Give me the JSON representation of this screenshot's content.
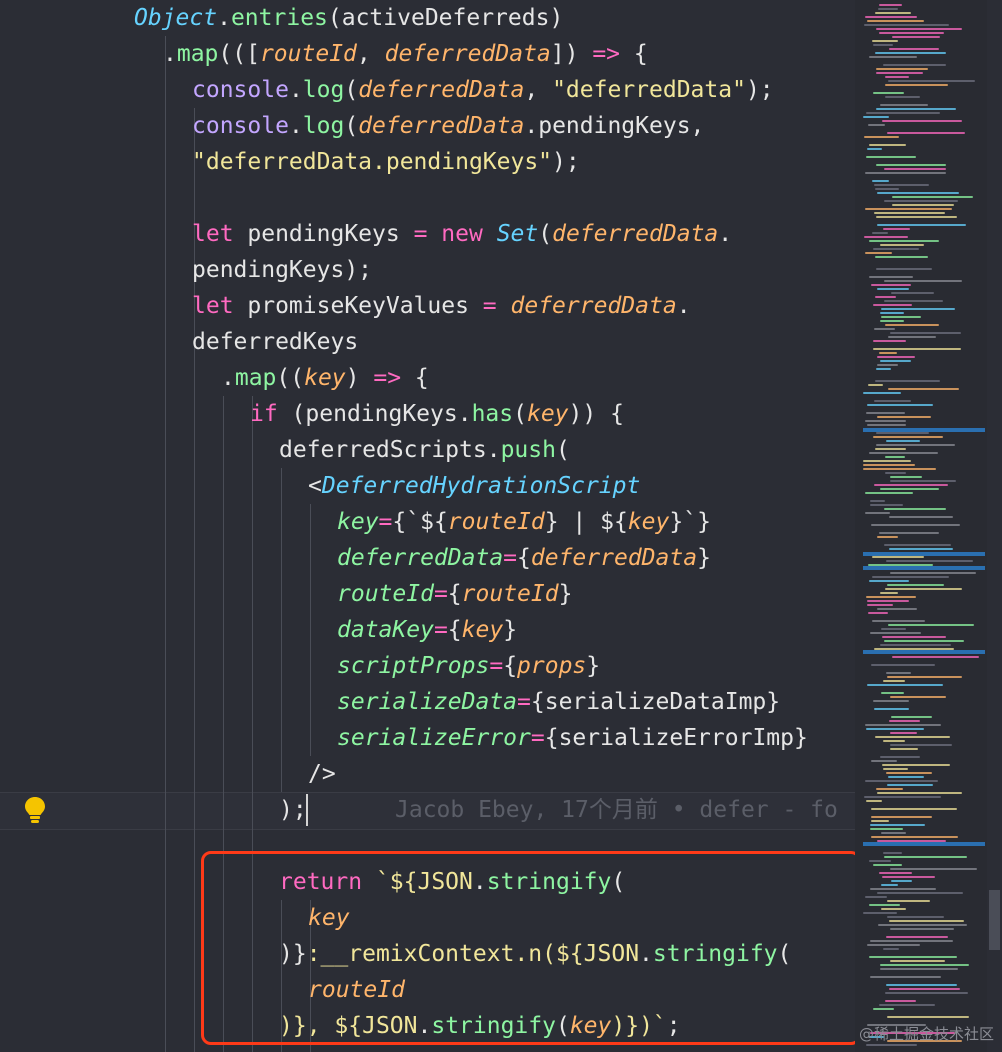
{
  "code_lines": [
    {
      "indent": 134,
      "tokens": [
        {
          "t": "Object",
          "c": "cls"
        },
        {
          "t": ".",
          "c": ""
        },
        {
          "t": "entries",
          "c": "fn"
        },
        {
          "t": "(activeDeferreds)",
          "c": ""
        }
      ]
    },
    {
      "indent": 163,
      "tokens": [
        {
          "t": ".",
          "c": ""
        },
        {
          "t": "map",
          "c": "fn"
        },
        {
          "t": "(([",
          "c": ""
        },
        {
          "t": "routeId",
          "c": "prm"
        },
        {
          "t": ", ",
          "c": ""
        },
        {
          "t": "deferredData",
          "c": "prm"
        },
        {
          "t": "]) ",
          "c": ""
        },
        {
          "t": "=>",
          "c": "op"
        },
        {
          "t": " {",
          "c": ""
        }
      ]
    },
    {
      "indent": 192,
      "tokens": [
        {
          "t": "console",
          "c": "obj"
        },
        {
          "t": ".",
          "c": ""
        },
        {
          "t": "log",
          "c": "fn"
        },
        {
          "t": "(",
          "c": ""
        },
        {
          "t": "deferredData",
          "c": "prm"
        },
        {
          "t": ", ",
          "c": ""
        },
        {
          "t": "\"deferredData\"",
          "c": "str"
        },
        {
          "t": ");",
          "c": ""
        }
      ]
    },
    {
      "indent": 192,
      "tokens": [
        {
          "t": "console",
          "c": "obj"
        },
        {
          "t": ".",
          "c": ""
        },
        {
          "t": "log",
          "c": "fn"
        },
        {
          "t": "(",
          "c": ""
        },
        {
          "t": "deferredData",
          "c": "prm"
        },
        {
          "t": ".pendingKeys,",
          "c": ""
        }
      ]
    },
    {
      "indent": 192,
      "tokens": [
        {
          "t": "\"deferredData.pendingKeys\"",
          "c": "str"
        },
        {
          "t": ");",
          "c": ""
        }
      ]
    },
    {
      "indent": 192,
      "tokens": []
    },
    {
      "indent": 192,
      "tokens": [
        {
          "t": "let",
          "c": "kw"
        },
        {
          "t": " pendingKeys ",
          "c": ""
        },
        {
          "t": "=",
          "c": "op"
        },
        {
          "t": " ",
          "c": ""
        },
        {
          "t": "new",
          "c": "kw"
        },
        {
          "t": " ",
          "c": ""
        },
        {
          "t": "Set",
          "c": "cls"
        },
        {
          "t": "(",
          "c": ""
        },
        {
          "t": "deferredData",
          "c": "prm"
        },
        {
          "t": ".",
          "c": ""
        }
      ]
    },
    {
      "indent": 192,
      "tokens": [
        {
          "t": "pendingKeys);",
          "c": ""
        }
      ]
    },
    {
      "indent": 192,
      "tokens": [
        {
          "t": "let",
          "c": "kw"
        },
        {
          "t": " promiseKeyValues ",
          "c": ""
        },
        {
          "t": "=",
          "c": "op"
        },
        {
          "t": " ",
          "c": ""
        },
        {
          "t": "deferredData",
          "c": "prm"
        },
        {
          "t": ".",
          "c": ""
        }
      ]
    },
    {
      "indent": 192,
      "tokens": [
        {
          "t": "deferredKeys",
          "c": ""
        }
      ]
    },
    {
      "indent": 221,
      "tokens": [
        {
          "t": ".",
          "c": ""
        },
        {
          "t": "map",
          "c": "fn"
        },
        {
          "t": "((",
          "c": ""
        },
        {
          "t": "key",
          "c": "prm"
        },
        {
          "t": ") ",
          "c": ""
        },
        {
          "t": "=>",
          "c": "op"
        },
        {
          "t": " {",
          "c": ""
        }
      ]
    },
    {
      "indent": 250,
      "tokens": [
        {
          "t": "if",
          "c": "kw"
        },
        {
          "t": " (pendingKeys.",
          "c": ""
        },
        {
          "t": "has",
          "c": "fn"
        },
        {
          "t": "(",
          "c": ""
        },
        {
          "t": "key",
          "c": "prm"
        },
        {
          "t": ")) {",
          "c": ""
        }
      ]
    },
    {
      "indent": 279,
      "tokens": [
        {
          "t": "deferredScripts.",
          "c": ""
        },
        {
          "t": "push",
          "c": "fn"
        },
        {
          "t": "(",
          "c": ""
        }
      ]
    },
    {
      "indent": 308,
      "tokens": [
        {
          "t": "<",
          "c": ""
        },
        {
          "t": "DeferredHydrationScript",
          "c": "tag"
        }
      ]
    },
    {
      "indent": 337,
      "tokens": [
        {
          "t": "key",
          "c": "attr"
        },
        {
          "t": "=",
          "c": "op"
        },
        {
          "t": "{`${",
          "c": ""
        },
        {
          "t": "routeId",
          "c": "prm"
        },
        {
          "t": "} | ${",
          "c": ""
        },
        {
          "t": "key",
          "c": "prm"
        },
        {
          "t": "}`}",
          "c": ""
        }
      ]
    },
    {
      "indent": 337,
      "tokens": [
        {
          "t": "deferredData",
          "c": "attr"
        },
        {
          "t": "=",
          "c": "op"
        },
        {
          "t": "{",
          "c": ""
        },
        {
          "t": "deferredData",
          "c": "prm"
        },
        {
          "t": "}",
          "c": ""
        }
      ]
    },
    {
      "indent": 337,
      "tokens": [
        {
          "t": "routeId",
          "c": "attr"
        },
        {
          "t": "=",
          "c": "op"
        },
        {
          "t": "{",
          "c": ""
        },
        {
          "t": "routeId",
          "c": "prm"
        },
        {
          "t": "}",
          "c": ""
        }
      ]
    },
    {
      "indent": 337,
      "tokens": [
        {
          "t": "dataKey",
          "c": "attr"
        },
        {
          "t": "=",
          "c": "op"
        },
        {
          "t": "{",
          "c": ""
        },
        {
          "t": "key",
          "c": "prm"
        },
        {
          "t": "}",
          "c": ""
        }
      ]
    },
    {
      "indent": 337,
      "tokens": [
        {
          "t": "scriptProps",
          "c": "attr"
        },
        {
          "t": "=",
          "c": "op"
        },
        {
          "t": "{",
          "c": ""
        },
        {
          "t": "props",
          "c": "prm"
        },
        {
          "t": "}",
          "c": ""
        }
      ]
    },
    {
      "indent": 337,
      "tokens": [
        {
          "t": "serializeData",
          "c": "attr"
        },
        {
          "t": "=",
          "c": "op"
        },
        {
          "t": "{serializeDataImp}",
          "c": ""
        }
      ]
    },
    {
      "indent": 337,
      "tokens": [
        {
          "t": "serializeError",
          "c": "attr"
        },
        {
          "t": "=",
          "c": "op"
        },
        {
          "t": "{serializeErrorImp}",
          "c": ""
        }
      ]
    },
    {
      "indent": 308,
      "tokens": [
        {
          "t": "/>",
          "c": ""
        }
      ]
    },
    {
      "indent": 279,
      "tokens": [
        {
          "t": ");",
          "c": ""
        }
      ]
    },
    {
      "indent": 279,
      "tokens": []
    },
    {
      "indent": 279,
      "tokens": [
        {
          "t": "return",
          "c": "kw"
        },
        {
          "t": " `${",
          "c": "str"
        },
        {
          "t": "JSON",
          "c": "str"
        },
        {
          "t": ".",
          "c": ""
        },
        {
          "t": "stringify",
          "c": "fn"
        },
        {
          "t": "(",
          "c": ""
        }
      ]
    },
    {
      "indent": 308,
      "tokens": [
        {
          "t": "key",
          "c": "prm"
        }
      ]
    },
    {
      "indent": 279,
      "tokens": [
        {
          "t": ")}",
          "c": ""
        },
        {
          "t": ":__remixContext.n(${",
          "c": "str"
        },
        {
          "t": "JSON",
          "c": "str"
        },
        {
          "t": ".",
          "c": ""
        },
        {
          "t": "stringify",
          "c": "fn"
        },
        {
          "t": "(",
          "c": ""
        }
      ]
    },
    {
      "indent": 308,
      "tokens": [
        {
          "t": "routeId",
          "c": "prm"
        }
      ]
    },
    {
      "indent": 279,
      "tokens": [
        {
          "t": ")}, ${",
          "c": "str"
        },
        {
          "t": "JSON",
          "c": "str"
        },
        {
          "t": ".",
          "c": ""
        },
        {
          "t": "stringify",
          "c": "fn"
        },
        {
          "t": "(",
          "c": ""
        },
        {
          "t": "key",
          "c": "prm"
        },
        {
          "t": ")})`",
          "c": "str"
        },
        {
          "t": ";",
          "c": ""
        }
      ]
    }
  ],
  "blame_annotation": "Jacob Ebey, 17个月前 • defer - fo",
  "watermark": "@稀土掘金技术社区",
  "icons": {
    "lightbulb": "lightbulb-icon"
  },
  "colors": {
    "background": "#2b2d35",
    "highlight_box": "#ff3a18",
    "keyword": "#ff6ac1",
    "function": "#8ef5a2",
    "parameter": "#ffb56b",
    "string": "#f1e69a",
    "class": "#66d3ff"
  }
}
